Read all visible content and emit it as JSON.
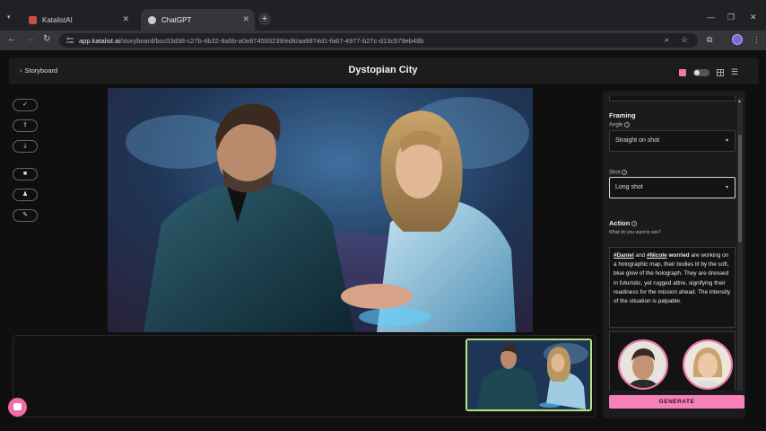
{
  "browser": {
    "tabs": [
      {
        "label": "KatalistAI",
        "favicon_color": "#d04a4a"
      },
      {
        "label": "ChatGPT",
        "favicon_color": "#cccccc"
      }
    ],
    "url_host": "app.katalist.ai",
    "url_path": "/storyboard/bcc03d38-c27b-4b32-8a5b-a0e874593239/edit/aa9874d1-fa67-4977-b27c-d13c579eb48b"
  },
  "header": {
    "back_label": "Storyboard",
    "title": "Dystopian City"
  },
  "framing": {
    "section_label": "Framing",
    "angle_label": "Angle",
    "angle_value": "Straight on shot",
    "shot_label": "Shot",
    "shot_value": "Long shot"
  },
  "action": {
    "label": "Action",
    "hint": "What do you want to see?",
    "mention1": "#Daniel",
    "and": " and ",
    "mention2": "#Nicole",
    "emph": " worried",
    "body": " are working on a holographic map, their bodies lit by the soft, blue glow of the holograph. They are dressed in futuristic, yet rugged attire, signifying their readiness for the mission ahead. The intensity of the situation is palpable."
  },
  "generate_label": "GENERATE",
  "colors": {
    "accent": "#f582b7",
    "thumb_border": "#b6e37c"
  }
}
